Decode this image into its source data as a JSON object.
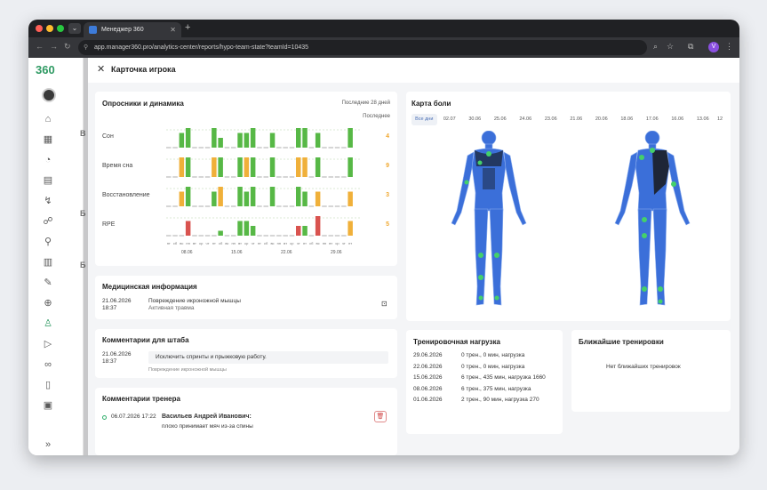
{
  "browser": {
    "tab_title": "Менеджер 360",
    "url": "app.manager360.pro/analytics-center/reports/hypo-team-state?teamId=10435",
    "profile_initial": "V"
  },
  "sidebar": {
    "logo": "360",
    "peek_letters": [
      "В",
      "Б",
      "Б"
    ]
  },
  "modal": {
    "title": "Карточка игрока",
    "surveys": {
      "title": "Опросники и динамика",
      "period": "Последние 28 дней",
      "last_label": "Последнее",
      "rows": [
        {
          "label": "Сон",
          "score": "4",
          "score_color": "#f0a830",
          "bars": [
            0,
            0,
            3,
            3,
            0,
            0,
            0,
            3,
            3,
            0,
            0,
            3,
            3,
            3,
            0,
            0,
            3,
            0,
            0,
            0,
            3,
            3,
            0,
            3,
            0,
            0,
            0,
            0,
            3
          ],
          "levels": [
            0,
            0,
            3,
            4,
            0,
            0,
            0,
            4,
            2,
            0,
            0,
            3,
            3,
            4,
            0,
            0,
            3,
            0,
            0,
            0,
            4,
            4,
            0,
            3,
            0,
            0,
            0,
            0,
            4
          ]
        },
        {
          "label": "Время сна",
          "score": "9",
          "score_color": "#f0a830",
          "bars": [
            0,
            0,
            2,
            3,
            0,
            0,
            0,
            2,
            3,
            0,
            0,
            3,
            2,
            3,
            0,
            0,
            3,
            0,
            0,
            0,
            2,
            2,
            0,
            3,
            0,
            0,
            0,
            0,
            3
          ],
          "levels": [
            0,
            0,
            4,
            4,
            0,
            0,
            0,
            4,
            4,
            0,
            0,
            4,
            4,
            4,
            0,
            0,
            4,
            0,
            0,
            0,
            4,
            4,
            0,
            4,
            0,
            0,
            0,
            0,
            4
          ]
        },
        {
          "label": "Восстановление",
          "score": "3",
          "score_color": "#f0a830",
          "bars": [
            0,
            0,
            2,
            3,
            0,
            0,
            0,
            3,
            2,
            0,
            0,
            3,
            3,
            3,
            0,
            0,
            3,
            0,
            0,
            0,
            3,
            3,
            0,
            2,
            0,
            0,
            0,
            0,
            2
          ],
          "levels": [
            0,
            0,
            3,
            4,
            0,
            0,
            0,
            3,
            4,
            0,
            0,
            4,
            3,
            4,
            0,
            0,
            4,
            0,
            0,
            0,
            4,
            3,
            0,
            3,
            0,
            0,
            0,
            0,
            3
          ]
        },
        {
          "label": "RPE",
          "score": "5",
          "score_color": "#f0a830",
          "bars": [
            0,
            0,
            0,
            1,
            0,
            0,
            0,
            0,
            3,
            0,
            0,
            3,
            3,
            3,
            0,
            0,
            0,
            0,
            0,
            0,
            1,
            3,
            0,
            1,
            0,
            0,
            0,
            0,
            2
          ],
          "levels": [
            0,
            0,
            0,
            3,
            0,
            0,
            0,
            0,
            1,
            0,
            0,
            3,
            3,
            2,
            0,
            0,
            0,
            0,
            0,
            0,
            2,
            2,
            0,
            4,
            0,
            0,
            0,
            0,
            3
          ]
        }
      ],
      "week_axis": [
        "08.06",
        "15.06",
        "22.06",
        "29.06"
      ]
    },
    "medical": {
      "title": "Медицинская информация",
      "date": "21.06.2026",
      "time": "18:37",
      "diagnosis": "Повреждение икроножной мышцы",
      "status": "Активная травма"
    },
    "staff_comments": {
      "title": "Комментарии для штаба",
      "date": "21.06.2026",
      "time": "18:37",
      "text": "Исключить спринты и прыжковую работу.",
      "tag": "Повреждение икроножной мышцы"
    },
    "coach_comments": {
      "title": "Комментарии тренера",
      "datetime": "06.07.2026 17:22",
      "author": "Васильев Андрей Иванович:",
      "text": "плохо принимает мяч из-за спины"
    },
    "pain_map": {
      "title": "Карта боли",
      "dates": [
        "Все дни",
        "02.07",
        "30.06",
        "25.06",
        "24.06",
        "23.06",
        "21.06",
        "20.06",
        "18.06",
        "17.06",
        "16.06",
        "13.06",
        "12"
      ]
    },
    "training_load": {
      "title": "Тренировочная нагрузка",
      "rows": [
        {
          "date": "29.06.2026",
          "value": "0 трен., 0 мин, нагрузка"
        },
        {
          "date": "22.06.2026",
          "value": "0 трен., 0 мин, нагрузка"
        },
        {
          "date": "15.06.2026",
          "value": "6 трен., 435 мин, нагрузка 1660"
        },
        {
          "date": "08.06.2026",
          "value": "6 трен., 375 мин, нагрузка"
        },
        {
          "date": "01.06.2026",
          "value": "2 трен., 90 мин, нагрузка 270"
        }
      ]
    },
    "upcoming": {
      "title": "Ближайшие тренировки",
      "empty": "Нет ближайших тренировок"
    }
  }
}
